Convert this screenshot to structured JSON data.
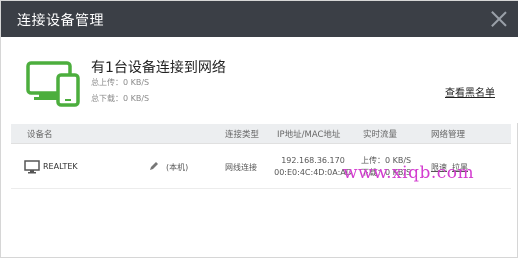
{
  "window": {
    "title": "连接设备管理",
    "close_icon": "close-icon"
  },
  "summary": {
    "headline": "有1台设备连接到网络",
    "upload": "总上传：0 KB/S",
    "download": "总下载：0 KB/S",
    "blacklist_link": "查看黑名单",
    "device_icon": "devices-icon",
    "accent_color": "#4cae3d"
  },
  "table": {
    "headers": {
      "device": "设备名",
      "type": "连接类型",
      "ipmac": "IP地址/MAC地址",
      "traffic": "实时流量",
      "manage": "网络管理"
    },
    "rows": [
      {
        "name": "REALTEK",
        "self_tag": "(本机)",
        "type": "网线连接",
        "ip": "192.168.36.170",
        "mac": "00:E0:4C:4D:0A:AD",
        "up": "上传：0 KB/S",
        "down": "下载：0 KB/S",
        "limit": "限速",
        "block": "拉黑"
      }
    ]
  },
  "watermark": "www.xiqb.com"
}
